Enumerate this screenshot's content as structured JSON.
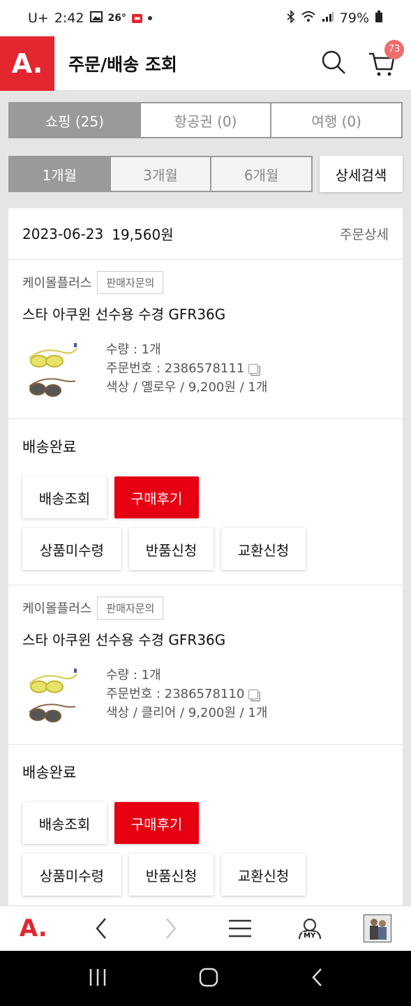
{
  "status": {
    "carrier": "U+",
    "time": "2:42",
    "temp": "26°",
    "battery": "79%"
  },
  "header": {
    "logo": "A.",
    "title": "주문/배송 조회",
    "cart_count": "73"
  },
  "category_tabs": [
    "쇼핑 (25)",
    "항공권 (0)",
    "여행 (0)"
  ],
  "period_tabs": [
    "1개월",
    "3개월",
    "6개월"
  ],
  "detail_search": "상세검색",
  "order": {
    "date": "2023-06-23",
    "total": "19,560원",
    "detail_label": "주문상세",
    "items": [
      {
        "seller": "케이몰플러스",
        "inquiry": "판매자문의",
        "product": "스타 아쿠윈 선수용 수경 GFR36G",
        "qty": "수량 : 1개",
        "order_no": "주문번호 : 2386578111",
        "option": "색상 / 옐로우 / 9,200원 / 1개",
        "status": "배송완료",
        "buttons": [
          "배송조회",
          "구매후기",
          "상품미수령",
          "반품신청",
          "교환신청"
        ]
      },
      {
        "seller": "케이몰플러스",
        "inquiry": "판매자문의",
        "product": "스타 아쿠윈 선수용 수경 GFR36G",
        "qty": "수량 : 1개",
        "order_no": "주문번호 : 2386578110",
        "option": "색상 / 클리어 / 9,200원 / 1개",
        "status": "배송완료",
        "buttons": [
          "배송조회",
          "구매후기",
          "상품미수령",
          "반품신청",
          "교환신청"
        ]
      }
    ]
  },
  "bottom_nav": {
    "logo": "A.",
    "my_label": "MY"
  },
  "colors": {
    "brand_red": "#e3262f",
    "button_red": "#e60012",
    "tab_gray": "#9a9a9a"
  }
}
